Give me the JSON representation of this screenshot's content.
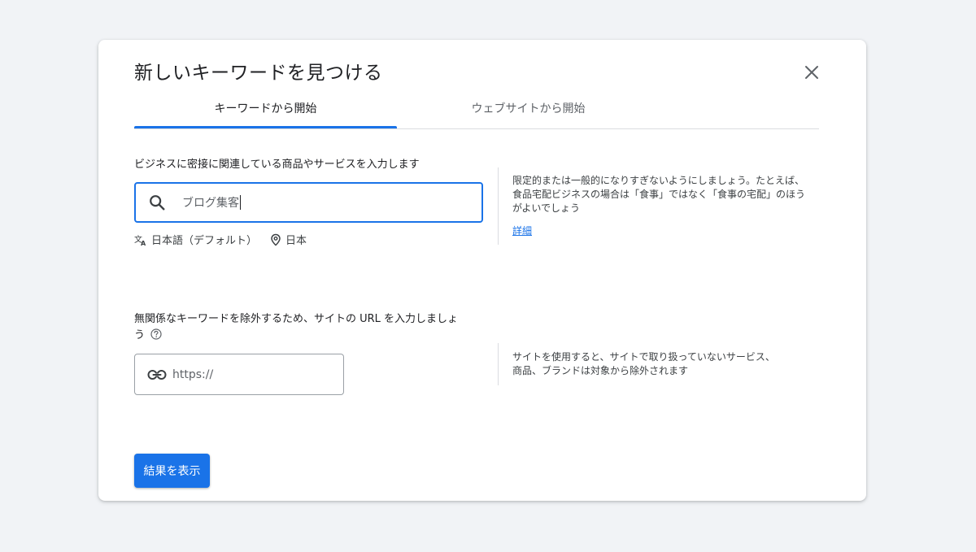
{
  "dialog": {
    "title": "新しいキーワードを見つける",
    "tabs": [
      {
        "label": "キーワードから開始",
        "active": true
      },
      {
        "label": "ウェブサイトから開始",
        "active": false
      }
    ],
    "accent_color": "#1a73e8"
  },
  "keyword_section": {
    "label": "ビジネスに密接に関連している商品やサービスを入力します",
    "input_value": "ブログ集客",
    "language": "日本語（デフォルト）",
    "location": "日本",
    "hint": "限定的または一般的になりすぎないようにしましょう。たとえば、食品宅配ビジネスの場合は「食事」ではなく「食事の宅配」のほうがよいでしょう",
    "hint_link": "詳細"
  },
  "url_section": {
    "label_line1": "無関係なキーワードを除外するため、サイトの URL を入力しましょ",
    "label_line2": "う",
    "placeholder": "https://",
    "hint_line1": "サイトを使用すると、サイトで取り扱っていないサービス、",
    "hint_line2": "商品、ブランドは対象から除外されます"
  },
  "actions": {
    "submit_label": "結果を表示"
  },
  "icons": {
    "close": "close-icon",
    "search": "search-icon",
    "translate": "translate-icon",
    "location": "location-pin-icon",
    "help": "help-circle-icon",
    "link": "link-icon"
  }
}
